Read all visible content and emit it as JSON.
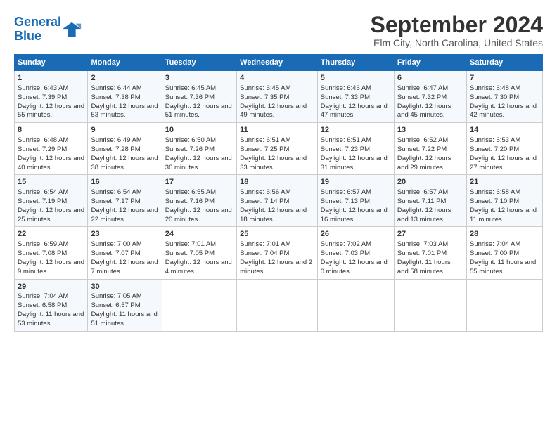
{
  "logo": {
    "line1": "General",
    "line2": "Blue"
  },
  "title": "September 2024",
  "subtitle": "Elm City, North Carolina, United States",
  "headers": [
    "Sunday",
    "Monday",
    "Tuesday",
    "Wednesday",
    "Thursday",
    "Friday",
    "Saturday"
  ],
  "weeks": [
    [
      {
        "day": "1",
        "sunrise": "6:43 AM",
        "sunset": "7:39 PM",
        "daylight": "12 hours and 55 minutes."
      },
      {
        "day": "2",
        "sunrise": "6:44 AM",
        "sunset": "7:38 PM",
        "daylight": "12 hours and 53 minutes."
      },
      {
        "day": "3",
        "sunrise": "6:45 AM",
        "sunset": "7:36 PM",
        "daylight": "12 hours and 51 minutes."
      },
      {
        "day": "4",
        "sunrise": "6:45 AM",
        "sunset": "7:35 PM",
        "daylight": "12 hours and 49 minutes."
      },
      {
        "day": "5",
        "sunrise": "6:46 AM",
        "sunset": "7:33 PM",
        "daylight": "12 hours and 47 minutes."
      },
      {
        "day": "6",
        "sunrise": "6:47 AM",
        "sunset": "7:32 PM",
        "daylight": "12 hours and 45 minutes."
      },
      {
        "day": "7",
        "sunrise": "6:48 AM",
        "sunset": "7:30 PM",
        "daylight": "12 hours and 42 minutes."
      }
    ],
    [
      {
        "day": "8",
        "sunrise": "6:48 AM",
        "sunset": "7:29 PM",
        "daylight": "12 hours and 40 minutes."
      },
      {
        "day": "9",
        "sunrise": "6:49 AM",
        "sunset": "7:28 PM",
        "daylight": "12 hours and 38 minutes."
      },
      {
        "day": "10",
        "sunrise": "6:50 AM",
        "sunset": "7:26 PM",
        "daylight": "12 hours and 36 minutes."
      },
      {
        "day": "11",
        "sunrise": "6:51 AM",
        "sunset": "7:25 PM",
        "daylight": "12 hours and 33 minutes."
      },
      {
        "day": "12",
        "sunrise": "6:51 AM",
        "sunset": "7:23 PM",
        "daylight": "12 hours and 31 minutes."
      },
      {
        "day": "13",
        "sunrise": "6:52 AM",
        "sunset": "7:22 PM",
        "daylight": "12 hours and 29 minutes."
      },
      {
        "day": "14",
        "sunrise": "6:53 AM",
        "sunset": "7:20 PM",
        "daylight": "12 hours and 27 minutes."
      }
    ],
    [
      {
        "day": "15",
        "sunrise": "6:54 AM",
        "sunset": "7:19 PM",
        "daylight": "12 hours and 25 minutes."
      },
      {
        "day": "16",
        "sunrise": "6:54 AM",
        "sunset": "7:17 PM",
        "daylight": "12 hours and 22 minutes."
      },
      {
        "day": "17",
        "sunrise": "6:55 AM",
        "sunset": "7:16 PM",
        "daylight": "12 hours and 20 minutes."
      },
      {
        "day": "18",
        "sunrise": "6:56 AM",
        "sunset": "7:14 PM",
        "daylight": "12 hours and 18 minutes."
      },
      {
        "day": "19",
        "sunrise": "6:57 AM",
        "sunset": "7:13 PM",
        "daylight": "12 hours and 16 minutes."
      },
      {
        "day": "20",
        "sunrise": "6:57 AM",
        "sunset": "7:11 PM",
        "daylight": "12 hours and 13 minutes."
      },
      {
        "day": "21",
        "sunrise": "6:58 AM",
        "sunset": "7:10 PM",
        "daylight": "12 hours and 11 minutes."
      }
    ],
    [
      {
        "day": "22",
        "sunrise": "6:59 AM",
        "sunset": "7:08 PM",
        "daylight": "12 hours and 9 minutes."
      },
      {
        "day": "23",
        "sunrise": "7:00 AM",
        "sunset": "7:07 PM",
        "daylight": "12 hours and 7 minutes."
      },
      {
        "day": "24",
        "sunrise": "7:01 AM",
        "sunset": "7:05 PM",
        "daylight": "12 hours and 4 minutes."
      },
      {
        "day": "25",
        "sunrise": "7:01 AM",
        "sunset": "7:04 PM",
        "daylight": "12 hours and 2 minutes."
      },
      {
        "day": "26",
        "sunrise": "7:02 AM",
        "sunset": "7:03 PM",
        "daylight": "12 hours and 0 minutes."
      },
      {
        "day": "27",
        "sunrise": "7:03 AM",
        "sunset": "7:01 PM",
        "daylight": "11 hours and 58 minutes."
      },
      {
        "day": "28",
        "sunrise": "7:04 AM",
        "sunset": "7:00 PM",
        "daylight": "11 hours and 55 minutes."
      }
    ],
    [
      {
        "day": "29",
        "sunrise": "7:04 AM",
        "sunset": "6:58 PM",
        "daylight": "11 hours and 53 minutes."
      },
      {
        "day": "30",
        "sunrise": "7:05 AM",
        "sunset": "6:57 PM",
        "daylight": "11 hours and 51 minutes."
      },
      null,
      null,
      null,
      null,
      null
    ]
  ]
}
